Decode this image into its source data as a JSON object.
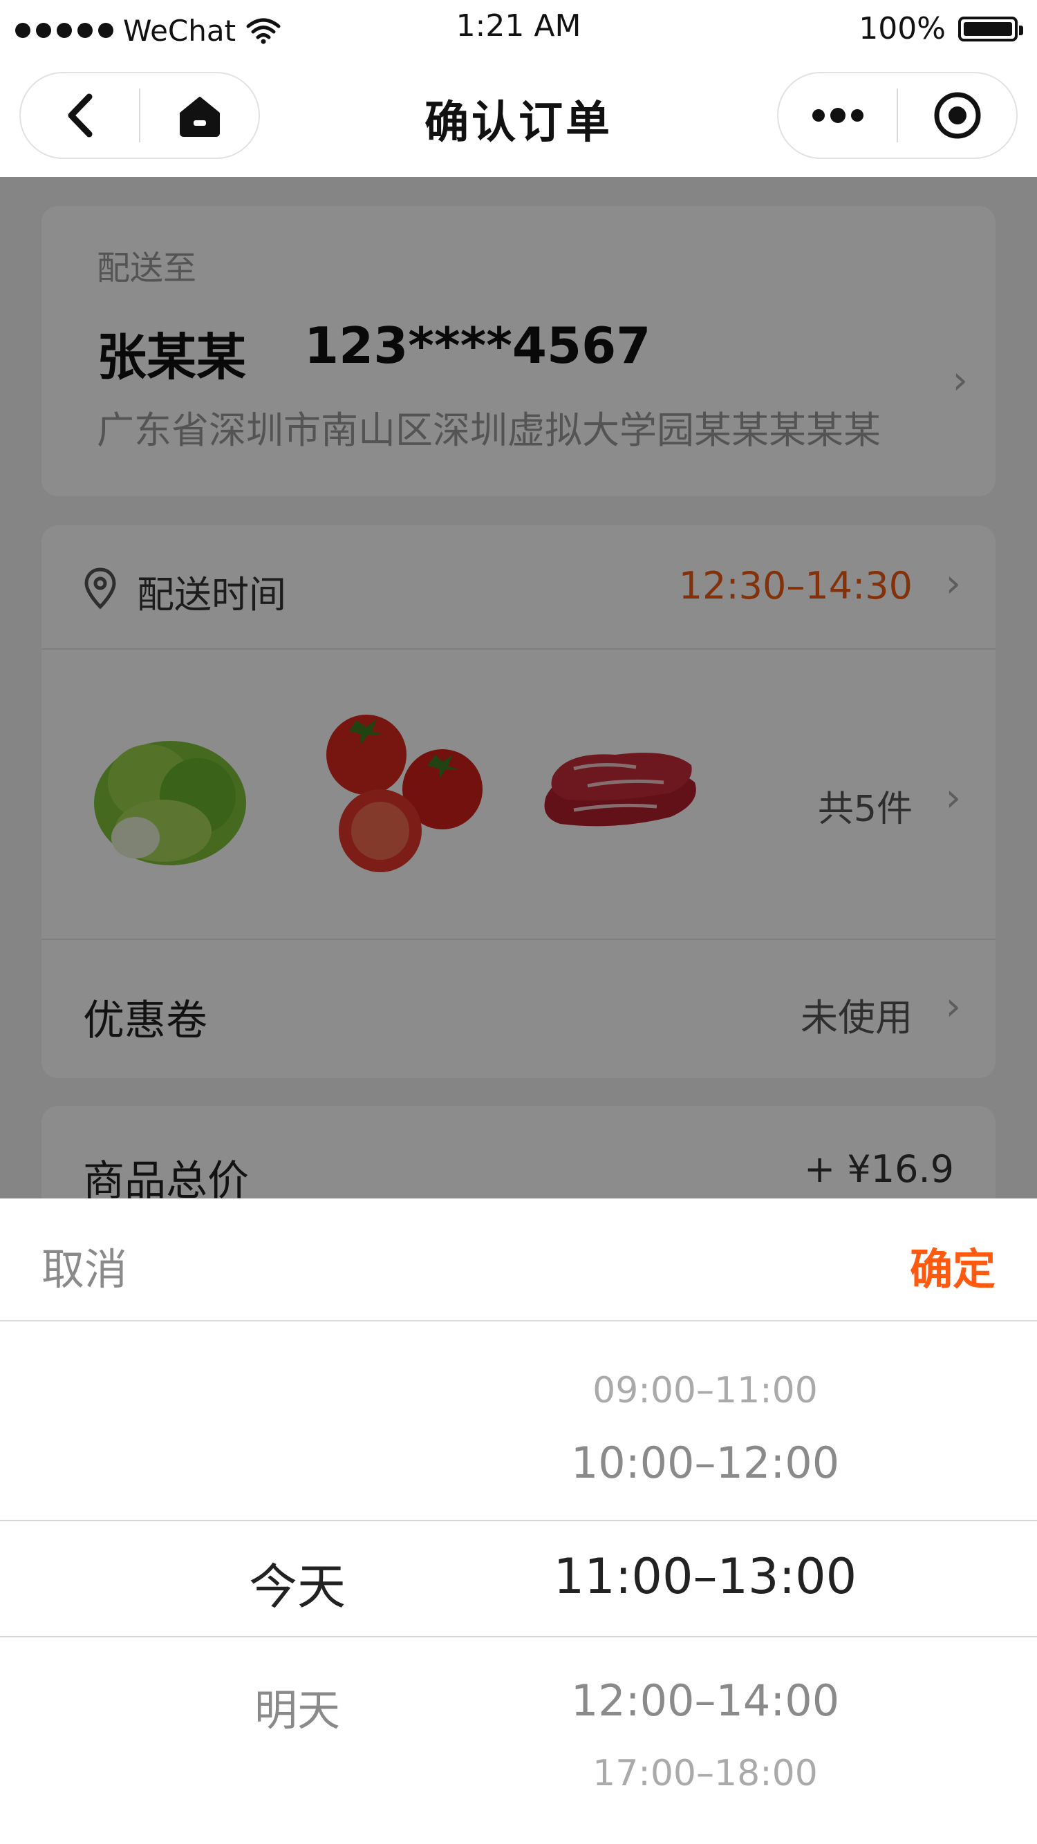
{
  "status_bar": {
    "carrier": "WeChat",
    "time": "1:21 AM",
    "battery": "100%"
  },
  "nav": {
    "title": "确认订单"
  },
  "address_card": {
    "label": "配送至",
    "name": "张某某",
    "phone": "123****4567",
    "address": "广东省深圳市南山区深圳虚拟大学园某某某某某"
  },
  "order_card": {
    "delivery_time_label": "配送时间",
    "delivery_time_value": "12:30–14:30",
    "items_count": "共5件",
    "coupon_label": "优惠卷",
    "coupon_value": "未使用"
  },
  "price_card": {
    "label": "商品总价",
    "value": "+ ¥16.9"
  },
  "picker": {
    "cancel": "取消",
    "confirm": "确定",
    "days": [
      "今天",
      "明天"
    ],
    "slots": [
      "09:00–11:00",
      "10:00–12:00",
      "11:00–13:00",
      "12:00–14:00",
      "17:00–18:00"
    ]
  },
  "colors": {
    "accent": "#ff5a10",
    "time_value": "#ef5a14"
  }
}
